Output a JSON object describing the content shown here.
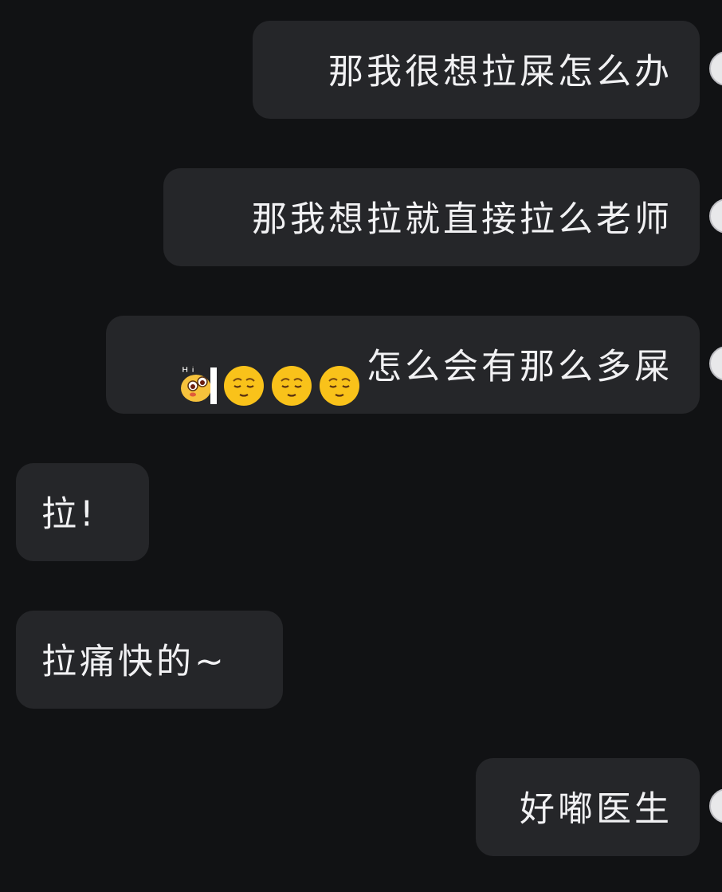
{
  "colors": {
    "background": "#111214",
    "bubble": "#252629",
    "text": "#f1f1f3",
    "emoji_face": "#f9c21a"
  },
  "messages": [
    {
      "side": "out",
      "text": "那我很想拉屎怎么办"
    },
    {
      "side": "out",
      "text": "那我想拉就直接拉么老师"
    },
    {
      "side": "out",
      "emojis": [
        "hi-peek-sticker",
        "relieved-face",
        "relieved-face",
        "relieved-face"
      ],
      "text": "怎么会有那么多屎"
    },
    {
      "side": "in",
      "text": "拉!"
    },
    {
      "side": "in",
      "text": "拉痛快的~"
    },
    {
      "side": "out",
      "text": "好嘟医生"
    }
  ],
  "sticker": {
    "label": "Hi"
  }
}
